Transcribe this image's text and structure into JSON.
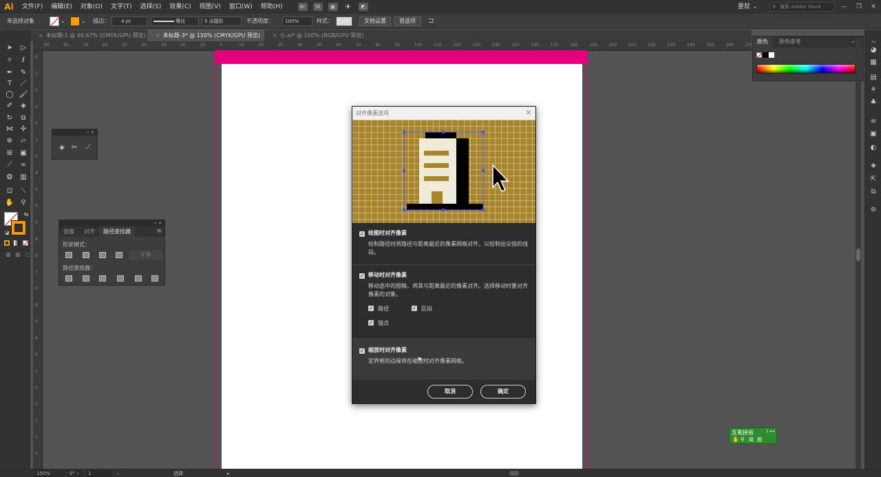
{
  "app": {
    "logo": "Ai"
  },
  "menu": [
    "文件(F)",
    "编辑(E)",
    "对象(O)",
    "文字(T)",
    "选择(S)",
    "效果(C)",
    "视图(V)",
    "窗口(W)",
    "帮助(H)"
  ],
  "menubar_icons": [
    "Br",
    "St"
  ],
  "workspace": "要就",
  "stock_search": {
    "placeholder": "搜索 Adobe Stock"
  },
  "control": {
    "selection_status": "未选择对象",
    "stroke_label": "描边：",
    "stroke_value": "4 pt",
    "stroke_style": "等比",
    "brush": "5 点圆形",
    "opacity_label": "不透明度：",
    "opacity_value": "100%",
    "style_label": "样式：",
    "doc_setup": "文档设置",
    "preferences": "首选项"
  },
  "tabs": [
    {
      "label": "未标题-1 @ 66.67% (CMYK/GPU 预览)",
      "active": false
    },
    {
      "label": "未标题-3* @ 150% (CMYK/GPU 预览)",
      "active": true
    },
    {
      "label": "小.ai* @ 100% (RGB/GPU 预览)",
      "active": false
    }
  ],
  "hruler_ticks": [
    "90",
    "80",
    "70",
    "60",
    "50",
    "40",
    "30",
    "20",
    "10",
    "0",
    "10",
    "20",
    "30",
    "40",
    "50",
    "60",
    "70",
    "80",
    "90",
    "100",
    "110",
    "120",
    "130",
    "140",
    "150",
    "160",
    "170",
    "180",
    "190",
    "200",
    "210",
    "220",
    "230",
    "240",
    "250",
    "260",
    "270"
  ],
  "vruler_ticks": [
    "0",
    "1",
    "0",
    "2",
    "0",
    "3",
    "0",
    "4",
    "0",
    "5",
    "0",
    "6",
    "0",
    "7",
    "0",
    "8",
    "0",
    "9",
    "0",
    "1",
    "0",
    "0",
    "1",
    "1",
    "0"
  ],
  "pathfinder_panel": {
    "tabs": [
      {
        "label": "变换",
        "active": false
      },
      {
        "label": "对齐",
        "active": false
      },
      {
        "label": "路径查找器",
        "active": true
      }
    ],
    "shape_modes_label": "形状模式：",
    "expand_label": "扩展",
    "pathfinders_label": "路径查找器："
  },
  "color_panel": {
    "tabs": [
      {
        "label": "颜色",
        "active": true
      },
      {
        "label": "颜色参考",
        "active": false
      }
    ]
  },
  "dialog": {
    "title": "对齐像素选项",
    "sections": [
      {
        "checkbox_label": "绘图时对齐像素",
        "checked": true,
        "description": "绘制路径时将路径与距离最近的像素网格对齐，以绘制出尖锐的线段。"
      },
      {
        "checkbox_label": "移动时对齐像素",
        "checked": true,
        "description": "移动选中的图稿，将其与距离最近的像素对齐。选择移动时要对齐像素的对象。",
        "sub_options": [
          {
            "label": "路径",
            "checked": true
          },
          {
            "label": "区段",
            "checked": true
          },
          {
            "label": "锚点",
            "checked": true
          }
        ]
      },
      {
        "checkbox_label": "缩放时对齐像素",
        "checked": true,
        "description": "定界框的边缘将在缩放时对齐像素网格。"
      }
    ],
    "cancel_label": "取消",
    "ok_label": "确定",
    "preview_bg": "#a8862e",
    "preview_shape": "#f0ead8"
  },
  "status": {
    "zoom": "150%",
    "angle": "0°",
    "artboard": "1",
    "tool": "选择"
  },
  "ime": {
    "name": "五笔拼音",
    "icons": [
      "☽",
      "••"
    ],
    "row2": [
      "简",
      "图"
    ]
  },
  "colors": {
    "accent": "#ff9a00",
    "bleed": "#e3007d",
    "selection": "#4050ff"
  }
}
